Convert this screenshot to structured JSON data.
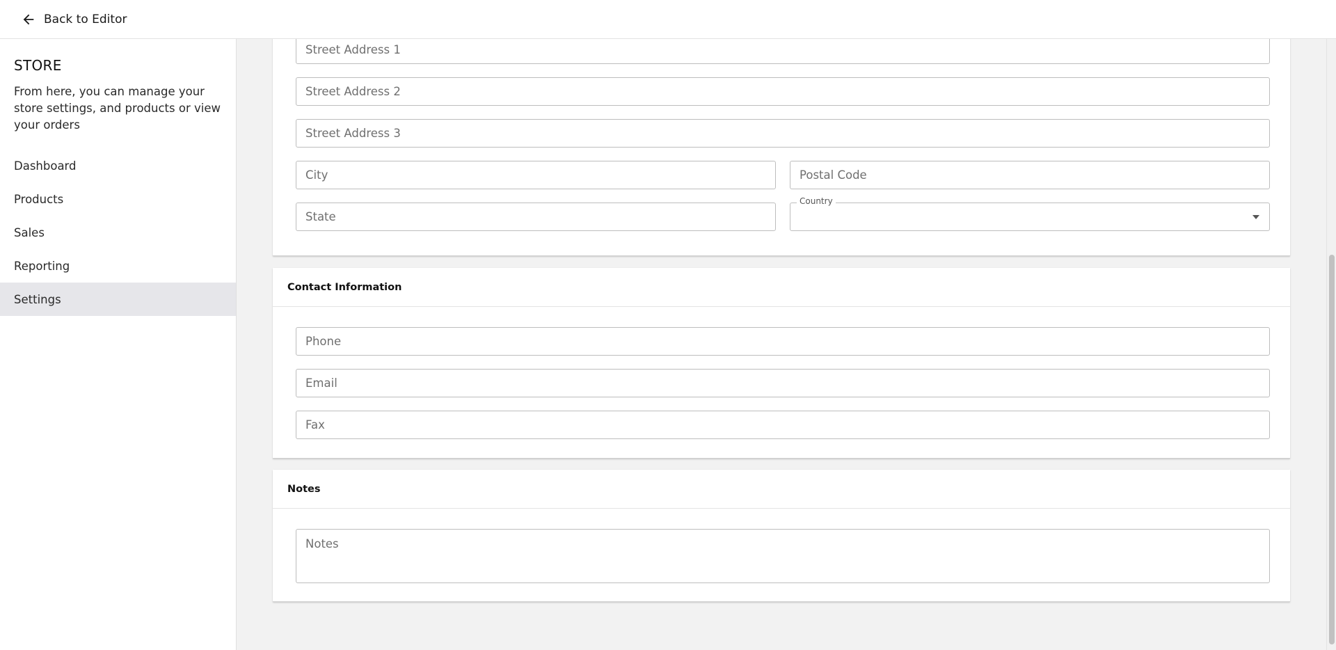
{
  "header": {
    "back_label": "Back to Editor",
    "back_icon": "arrow-left-icon"
  },
  "sidebar": {
    "title": "STORE",
    "description": "From here, you can manage your store settings, and products or view your orders",
    "items": [
      {
        "label": "Dashboard",
        "active": false
      },
      {
        "label": "Products",
        "active": false
      },
      {
        "label": "Sales",
        "active": false
      },
      {
        "label": "Reporting",
        "active": false
      },
      {
        "label": "Settings",
        "active": true
      }
    ]
  },
  "address": {
    "street1_placeholder": "Street Address 1",
    "street2_placeholder": "Street Address 2",
    "street3_placeholder": "Street Address 3",
    "city_placeholder": "City",
    "postal_placeholder": "Postal Code",
    "state_placeholder": "State",
    "country_label": "Country",
    "country_value": ""
  },
  "contact": {
    "title": "Contact Information",
    "phone_placeholder": "Phone",
    "email_placeholder": "Email",
    "fax_placeholder": "Fax"
  },
  "notes": {
    "title": "Notes",
    "notes_placeholder": "Notes"
  },
  "colors": {
    "active_nav_bg": "#e6e6ea",
    "page_bg": "#f2f2f2"
  }
}
